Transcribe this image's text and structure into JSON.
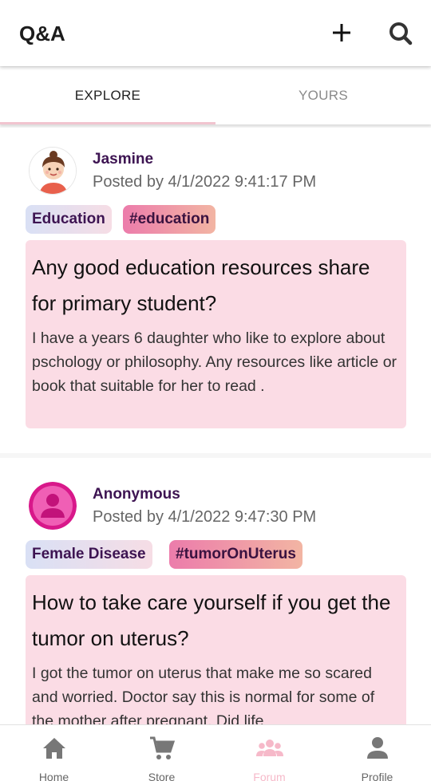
{
  "appbar": {
    "title": "Q&A",
    "add_icon": "plus-icon",
    "search_icon": "search-icon"
  },
  "tabs": [
    {
      "label": "EXPLORE",
      "active": true
    },
    {
      "label": "YOURS",
      "active": false
    }
  ],
  "posts": [
    {
      "author": "Jasmine",
      "posted": "Posted by 4/1/2022 9:41:17 PM",
      "avatar": "girl-avatar",
      "category": "Education",
      "tag": "#education",
      "title": "Any good education resources share for primary student?",
      "text": "I have a years 6 daughter who like to explore about pschology or philosophy. Any resources like article or book  that suitable for her to read ."
    },
    {
      "author": "Anonymous",
      "posted": "Posted by 4/1/2022 9:47:30 PM",
      "avatar": "anonymous-user-avatar",
      "category": "Female Disease",
      "tag": "#tumorOnUterus",
      "title": "How to take care yourself if you get the tumor on uterus?",
      "text": "I got the tumor on uterus that make me so scared and worried. Doctor say this is normal for some of the mother after pregnant. Did life"
    }
  ],
  "bottom_nav": [
    {
      "label": "Home",
      "icon": "home-icon",
      "active": false
    },
    {
      "label": "Store",
      "icon": "cart-icon",
      "active": false
    },
    {
      "label": "Forum",
      "icon": "group-icon",
      "active": true
    },
    {
      "label": "Profile",
      "icon": "person-icon",
      "active": false
    }
  ],
  "colors": {
    "accent_pink": "#f6b9c9",
    "author_purple": "#3d1452",
    "card_body_bg": "#fbdce5",
    "inactive_gray": "#888888"
  }
}
